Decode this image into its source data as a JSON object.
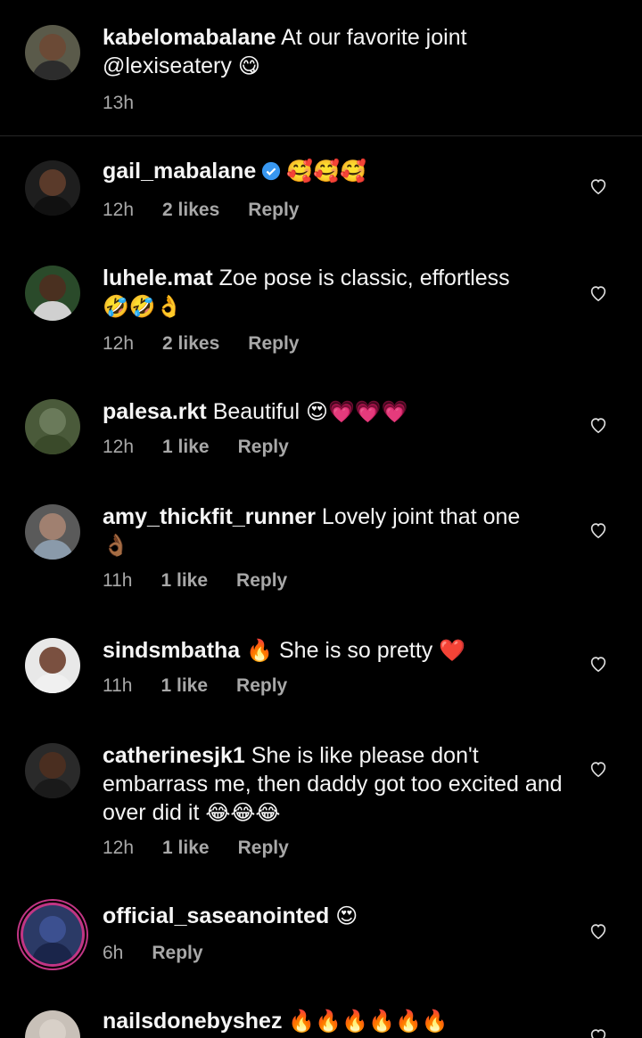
{
  "caption": {
    "username": "kabelomabalane",
    "text": "At our favorite joint @lexiseatery",
    "emoji": "😋",
    "time": "13h"
  },
  "comments": [
    {
      "username": "gail_mabalane",
      "verified": true,
      "text": "",
      "emoji": "🥰🥰🥰",
      "time": "12h",
      "likes": "2 likes",
      "reply": "Reply"
    },
    {
      "username": "luhele.mat",
      "text": "Zoe pose is classic, effortless",
      "emoji": "🤣🤣👌",
      "time": "12h",
      "likes": "2 likes",
      "reply": "Reply"
    },
    {
      "username": "palesa.rkt",
      "text": "Beautiful",
      "emoji": "😍💗💗💗",
      "time": "12h",
      "likes": "1 like",
      "reply": "Reply"
    },
    {
      "username": "amy_thickfit_runner",
      "text": "Lovely joint that one",
      "emoji": "👌🏾",
      "time": "11h",
      "likes": "1 like",
      "reply": "Reply"
    },
    {
      "username": "sindsmbatha",
      "text": "She is so pretty",
      "emoji_before": "🔥",
      "emoji": "❤️",
      "time": "11h",
      "likes": "1 like",
      "reply": "Reply"
    },
    {
      "username": "catherinesjk1",
      "text": "She is like please don't embarrass me, then daddy got too excited and over did it",
      "emoji": "😂😂😂",
      "time": "12h",
      "likes": "1 like",
      "reply": "Reply"
    },
    {
      "username": "official_saseanointed",
      "text": "",
      "emoji": "😍",
      "time": "6h",
      "likes": "",
      "reply": "Reply"
    },
    {
      "username": "nailsdonebyshez",
      "text": "",
      "emoji": "🔥🔥🔥🔥🔥🔥",
      "time": "",
      "likes": "",
      "reply": ""
    }
  ],
  "icons": {
    "like": "heart-outline-icon",
    "verified": "verified-badge-icon"
  },
  "colors": {
    "background": "#000000",
    "text": "#f5f5f5",
    "secondary": "#a8a8a8",
    "verified": "#3897f0"
  }
}
